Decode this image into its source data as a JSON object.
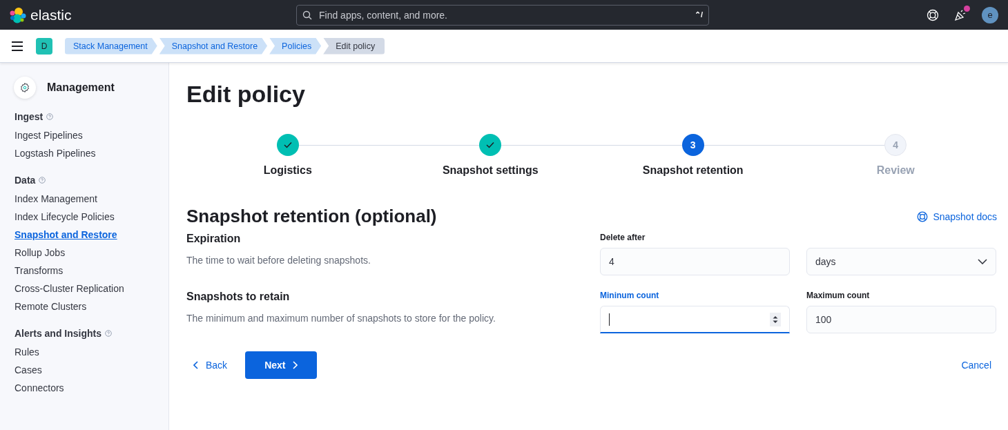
{
  "header": {
    "brand": "elastic",
    "search": {
      "placeholder": "Find apps, content, and more.",
      "shortcut": "⌃/"
    },
    "avatar": "e",
    "notification": true
  },
  "breadcrumb_bar": {
    "space": "D",
    "breadcrumbs": [
      {
        "label": "Stack Management",
        "selected": false
      },
      {
        "label": "Snapshot and Restore",
        "selected": false
      },
      {
        "label": "Policies",
        "selected": false
      },
      {
        "label": "Edit policy",
        "selected": true
      }
    ]
  },
  "sidebar": {
    "title": "Management",
    "sections": [
      {
        "title": "Ingest",
        "items": [
          {
            "label": "Ingest Pipelines",
            "selected": false
          },
          {
            "label": "Logstash Pipelines",
            "selected": false
          }
        ]
      },
      {
        "title": "Data",
        "items": [
          {
            "label": "Index Management",
            "selected": false
          },
          {
            "label": "Index Lifecycle Policies",
            "selected": false
          },
          {
            "label": "Snapshot and Restore",
            "selected": true
          },
          {
            "label": "Rollup Jobs",
            "selected": false
          },
          {
            "label": "Transforms",
            "selected": false
          },
          {
            "label": "Cross-Cluster Replication",
            "selected": false
          },
          {
            "label": "Remote Clusters",
            "selected": false
          }
        ]
      },
      {
        "title": "Alerts and Insights",
        "items": [
          {
            "label": "Rules",
            "selected": false
          },
          {
            "label": "Cases",
            "selected": false
          },
          {
            "label": "Connectors",
            "selected": false
          }
        ]
      }
    ]
  },
  "page_title": "Edit policy",
  "steps": [
    {
      "label": "Logistics",
      "complete": true,
      "selected": false
    },
    {
      "label": "Snapshot settings",
      "complete": true,
      "selected": false
    },
    {
      "label": "Snapshot retention",
      "number": "3",
      "complete": false,
      "selected": true
    },
    {
      "label": "Review",
      "number": "4",
      "complete": false,
      "selected": false
    }
  ],
  "section": {
    "title": "Snapshot retention (optional)",
    "docs_link": "Snapshot docs",
    "groups": [
      {
        "title": "Expiration",
        "description": "The time to wait before deleting snapshots.",
        "fields": [
          {
            "kind": "text",
            "label": "Delete after",
            "value": "4",
            "focused": false
          },
          {
            "kind": "select",
            "value": "days",
            "focused": false
          }
        ]
      },
      {
        "title": "Snapshots to retain",
        "description": "The minimum and maximum number of snapshots to store for the policy.",
        "fields": [
          {
            "kind": "number",
            "label": "Mininum count",
            "focused": true
          },
          {
            "kind": "text",
            "label": "Maximum count",
            "value": "100",
            "focused": false
          }
        ]
      }
    ]
  },
  "footer": {
    "back": "Back",
    "next": "Next",
    "cancel": "Cancel"
  }
}
